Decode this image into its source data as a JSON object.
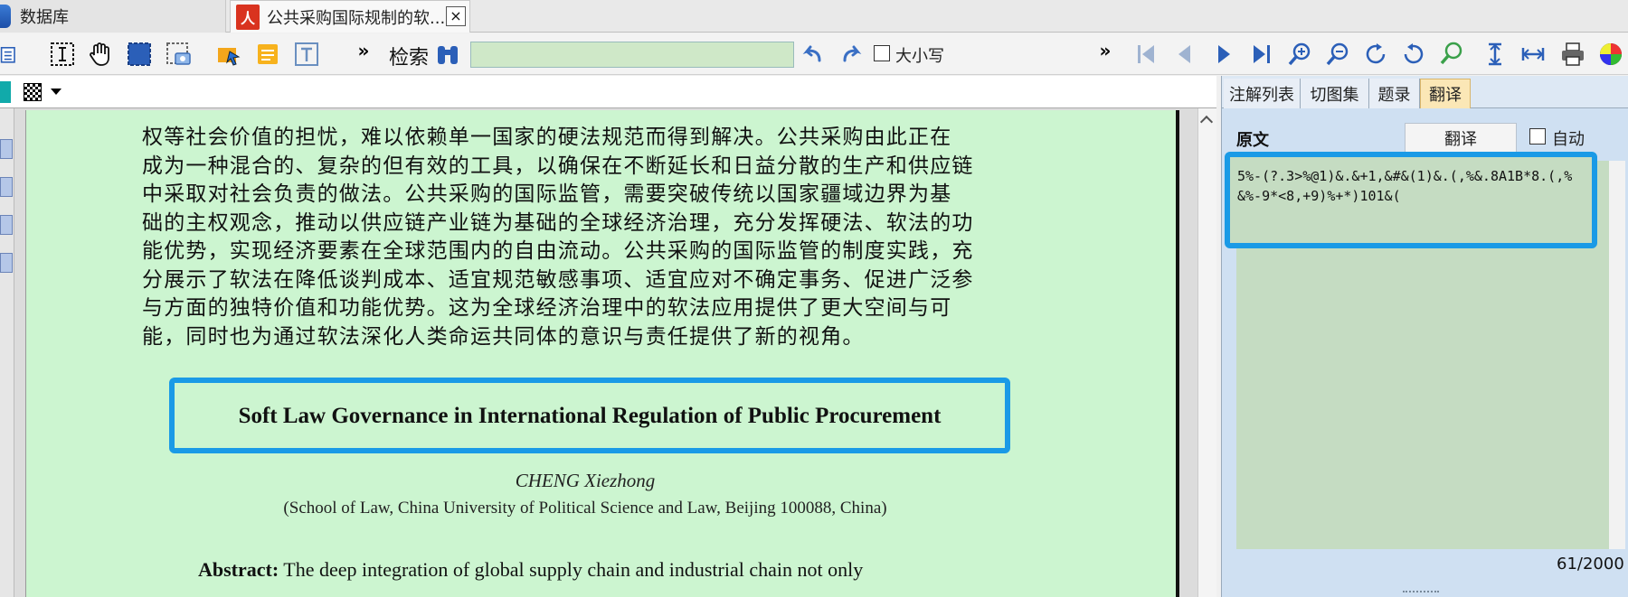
{
  "tabs": [
    {
      "label": "数据库"
    },
    {
      "label": "公共采购国际规制的软...",
      "close": "×",
      "icon_text": "人"
    }
  ],
  "toolbar": {
    "search_label": "检索",
    "search_value": "",
    "case_label": "大小写",
    "more": "»"
  },
  "document": {
    "cn_lines": [
      "权等社会价值的担忧，难以依赖单一国家的硬法规范而得到解决。公共采购由此正在",
      "成为一种混合的、复杂的但有效的工具，以确保在不断延长和日益分散的生产和供应链",
      "中采取对社会负责的做法。公共采购的国际监管，需要突破传统以国家疆域边界为基",
      "础的主权观念，推动以供应链产业链为基础的全球经济治理，充分发挥硬法、软法的功",
      "能优势，实现经济要素在全球范围内的自由流动。公共采购的国际监管的制度实践，充",
      "分展示了软法在降低谈判成本、适宜规范敏感事项、适宜应对不确定事务、促进广泛参",
      "与方面的独特价值和功能优势。这为全球经济治理中的软法应用提供了更大空间与可",
      "能，同时也为通过软法深化人类命运共同体的意识与责任提供了新的视角。"
    ],
    "en_title": "Soft Law Governance in International Regulation of Public Procurement",
    "author": "CHENG Xiezhong",
    "affiliation": "(School of Law, China University of Political Science and Law, Beijing 100088, China)",
    "abstract_label": "Abstract:",
    "abstract_text": " The deep integration of global supply chain and industrial chain not only"
  },
  "right_panel": {
    "tabs": [
      "注解列表",
      "切图集",
      "题录",
      "翻译"
    ],
    "active_tab": "翻译",
    "orig_label": "原文",
    "translate_button": "翻译",
    "auto_label": "自动",
    "orig_text": "5%-(?.3>%@1)&.&+1,&#&(1)&.(,%&.8A1B*8.(,%&%-9*<8,+9)%+*)101&(",
    "counter": "61/2000"
  },
  "colors": {
    "highlight": "#1a9ae6",
    "page_bg": "#ccf5d0",
    "active_tab": "#fbe7b6"
  }
}
